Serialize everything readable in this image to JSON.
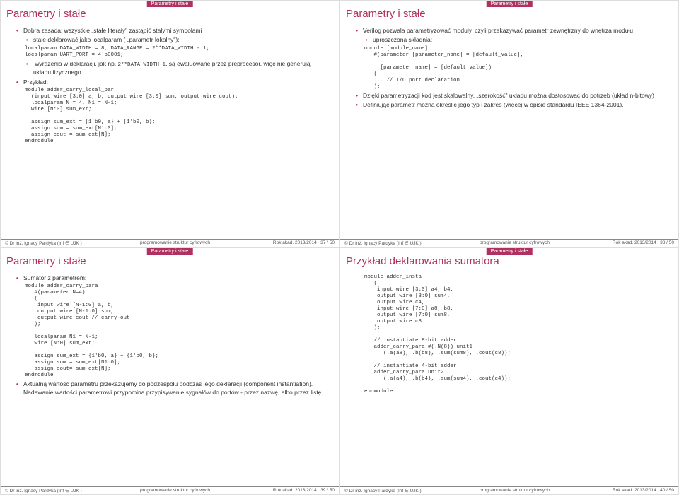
{
  "section_label": "Parametry i stałe",
  "slide1": {
    "title": "Parametry i stałe",
    "b1": "Dobra zasada: wszystkie „stałe literały\" zastąpić stałymi symbolami",
    "b2": "stałe deklarować jako localparam ( „parametr lokalny\"):",
    "code1": "localparam DATA_WIDTH = 8, DATA_RANGE = 2**DATA_WIDTH - 1;\nlocalparam UART_PORT = 4'b0001;",
    "b3": "wyrażenia w deklaracji, jak np. ",
    "b3code": "2**DATA_WIDTH-1",
    "b3cont": ", są ewaluowane przez preprocesor, więc nie generują układu fizycznego",
    "b4": "Przykład:",
    "code2": "module adder_carry_local_par\n  (input wire [3:0] a, b, output wire [3:0] sum, output wire cout);\n  localparam N = 4, N1 = N-1;\n  wire [N:0] sum_ext;\n\n  assign sum_ext = {1'b0, a} + {1'b0, b};\n  assign sum = sum_ext[N1:0];\n  assign cout = sum_ext[N];\nendmodule"
  },
  "slide2": {
    "title": "Parametry i stałe",
    "b1": "Verilog pozwala parametryzować moduły, czyli przekazywać parametr zewnętrzny do wnętrza modułu",
    "b2": "uproszczona składnia:",
    "code1": "module [module_name]\n   #(parameter [parameter_name] = [default_value],\n     ...\n     [parameter_name] = [default_value])\n   (\n   ... // I/O port declaration\n   );",
    "b3": "Dzięki parametryzacji kod jest skalowalny, „szerokość\" układu można dostosować do potrzeb (układ n-bitowy)",
    "b4": "Definiując parametr można określić jego typ i zakres (więcej w opisie standardu IEEE 1364-2001)."
  },
  "slide3": {
    "title": "Parametry i stałe",
    "b1": "Sumator z parametrem:",
    "code1": "module adder_carry_para\n   #(parameter N=4)\n   (\n    input wire [N-1:0] a, b,\n    output wire [N-1:0] sum,\n    output wire cout // carry-out\n   );\n\n   localparam N1 = N-1;\n   wire [N:0] sum_ext;\n\n   assign sum_ext = {1'b0, a} + {1'b0, b};\n   assign sum = sum_ext[N1:0];\n   assign cout= sum_ext[N];\nendmodule",
    "b2": "Aktualną wartość parametru przekazujemy do podzespołu podczas jego deklaracji (component instantiation). Nadawanie wartości parametrowi przypomina przypisywanie sygnałów do portów - przez nazwę, albo przez listę."
  },
  "slide4": {
    "title": "Przykład deklarowania sumatora",
    "code1": "module adder_insta\n   (\n    input wire [3:0] a4, b4,\n    output wire [3:0] sum4,\n    output wire c4,\n    input wire [7:0] a8, b8,\n    output wire [7:0] sum8,\n    output wire c8\n   );\n\n   // instantiate 8-bit adder\n   adder_carry_para #(.N(8)) unit1\n      (.a(a8), .b(b8), .sum(sum8), .cout(c8));\n\n   // instantiate 4-bit adder\n   adder_carry_para unit2\n      (.a(a4), .b(b4), .sum(sum4), .cout(c4));\n\nendmodule"
  },
  "footer": {
    "author": "© Dr inż. Ignacy Pardyka (Inf ∈ UJK )",
    "mid": "programowanie struktur cyfrowych",
    "year": "Rok akad. 2013/2014",
    "p1": "37 / 50",
    "p2": "38 / 50",
    "p3": "39 / 50",
    "p4": "40 / 50"
  }
}
